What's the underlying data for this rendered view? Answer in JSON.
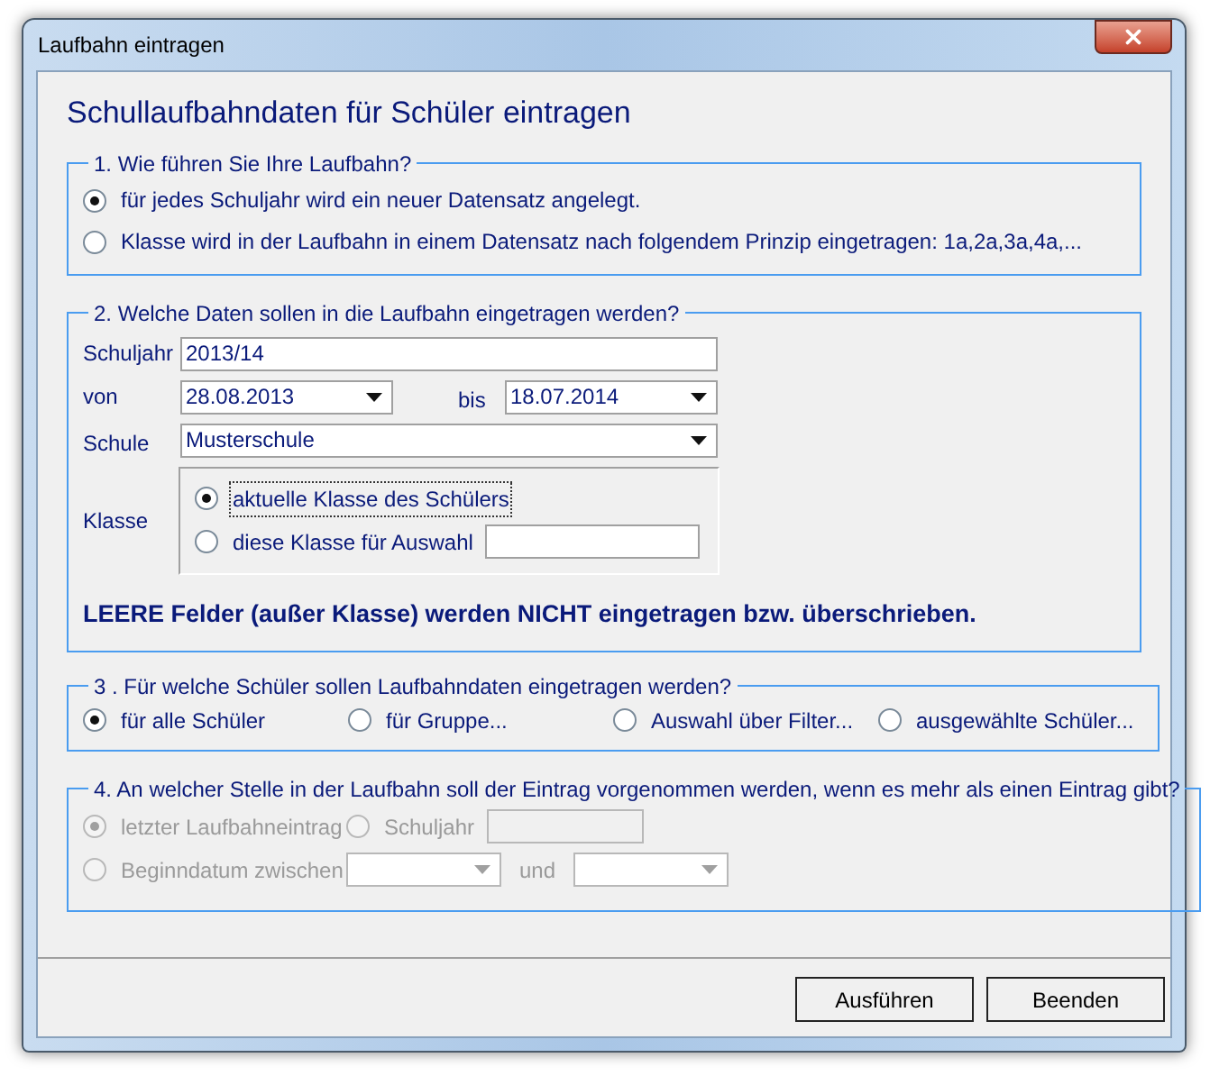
{
  "window": {
    "title": "Laufbahn eintragen"
  },
  "heading": "Schullaufbahndaten für Schüler eintragen",
  "section1": {
    "legend": "1. Wie führen Sie Ihre Laufbahn?",
    "options": [
      {
        "label": "für jedes Schuljahr wird ein neuer Datensatz angelegt.",
        "selected": true
      },
      {
        "label": "Klasse wird in der Laufbahn in einem Datensatz nach folgendem Prinzip eingetragen: 1a,2a,3a,4a,...",
        "selected": false
      }
    ]
  },
  "section2": {
    "legend": "2. Welche Daten sollen in die Laufbahn eingetragen werden?",
    "schuljahr": {
      "label": "Schuljahr",
      "value": "2013/14"
    },
    "von": {
      "label": "von",
      "value": "28.08.2013"
    },
    "bis": {
      "label": "bis",
      "value": "18.07.2014"
    },
    "schule": {
      "label": "Schule",
      "value": "Musterschule"
    },
    "klasse": {
      "label": "Klasse",
      "options": [
        {
          "label": "aktuelle Klasse des Schülers",
          "selected": true,
          "focused": true
        },
        {
          "label": "diese Klasse für Auswahl",
          "selected": false,
          "focused": false
        }
      ]
    },
    "note": "LEERE Felder (außer Klasse) werden NICHT eingetragen bzw. überschrieben."
  },
  "section3": {
    "legend": "3 . Für welche Schüler sollen Laufbahndaten eingetragen werden?",
    "options": [
      {
        "label": "für alle Schüler",
        "selected": true
      },
      {
        "label": "für Gruppe...",
        "selected": false
      },
      {
        "label": "Auswahl über Filter...",
        "selected": false
      },
      {
        "label": "ausgewählte Schüler...",
        "selected": false
      }
    ]
  },
  "section4": {
    "legend": "4. An welcher Stelle in der Laufbahn soll der Eintrag vorgenommen werden, wenn es mehr als einen Eintrag gibt?",
    "disabled": true,
    "last": {
      "label": "letzter Laufbahneintrag",
      "selected": true
    },
    "year": {
      "label": "Schuljahr",
      "selected": false
    },
    "begin": {
      "label": "Beginndatum zwischen",
      "selected": false
    },
    "and": "und"
  },
  "buttons": [
    "Ausführen",
    "Beenden"
  ]
}
